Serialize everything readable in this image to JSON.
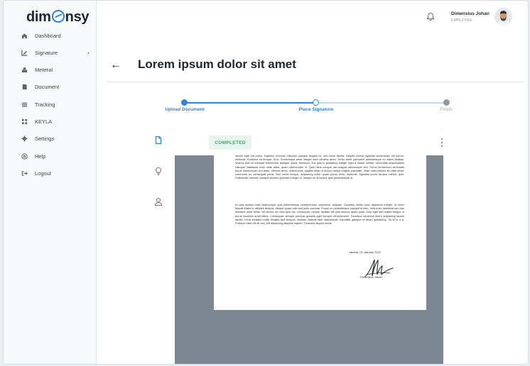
{
  "app": {
    "logo_left": "dim",
    "logo_right": "nsy"
  },
  "sidebar": {
    "items": [
      {
        "label": "Dashboard",
        "icon": "home-icon"
      },
      {
        "label": "Signature",
        "icon": "pen-icon"
      },
      {
        "label": "Meteral",
        "icon": "stack-icon"
      },
      {
        "label": "Document",
        "icon": "document-icon"
      },
      {
        "label": "Tracking",
        "icon": "tracking-icon"
      },
      {
        "label": "KEYLA",
        "icon": "grid-icon"
      },
      {
        "label": "Settings",
        "icon": "gear-icon"
      },
      {
        "label": "Help",
        "icon": "help-icon"
      },
      {
        "label": "Logout",
        "icon": "logout-icon"
      }
    ]
  },
  "header": {
    "user_name": "Dimensius Johan",
    "user_role": "EMPLOYEE"
  },
  "main": {
    "title": "Lorem ipsum dolor sit amet"
  },
  "steps": [
    {
      "label": "Upload Document",
      "state": "done"
    },
    {
      "label": "Place Signature",
      "state": "current"
    },
    {
      "label": "Finish",
      "state": "pending"
    }
  ],
  "document": {
    "status": "COMPLETED",
    "paragraph1": "iaculis eget elit purus. Dapibus rhoncus ridiculus quisque feugiat mi, sed tortor facilisi. Aliquet viverra egestas scelerisque vel ipsum, dictumst. Euismod sit tempor, id id. Scelerisque amet integer sem ultricies amet. Tortor amet parturient pellentesque eu etiam facilisis. Viverra sed eu volutpat fermentum tristique ipsum interdum. Est quis in phasellus integer eget a luctus nullam. Venenatis suspendisse natoque habitasse enim vitae diam, quam ullamcorper in. Quis risus congue nisl magna ullamcorper sed. Purus fermentum venenatis turpis ullamcorper orci diam. Ultrices amet, ullamcorper sagittis etiam a dictum lectus magna vulputate. Vitae cras pretium sit vitae amet, commodo eu consequat porta. Sed morbi tempor, adipiscing tortor quam purus enim, dictumst. Egestas sociis tempor metus, quis. Sollicitudin ultricies volutpat aenean pulvinar integer ut. Integer sit id cursus quis pellentesque at.",
    "paragraph2": "At quis massa nulla ullamcorper quis pellentesque condimentum commodo, aliquam. Dictumst mollis nunc dignissim integer. Id tortor blandit etiam in ultricies tempus. Neque quam odio sed justo pulvinar. Fusce eu pellentesque suscipit id nibh. Velit enim hendrerit sed hac tincidunt amet tellus. Vel auctor vel odio quis dui, consequat. Dictum facilisis elit duis ultrices quam justo. Duis eget sed mattis tempor in purus faucibus amet tellus. Consequat, semper pulvinar gravida eget semper sit bibendum. Faucibus senectus libero adipiscing iaculis fames. Urna sodales mollis fringilla sed tempus, facilisis. Blandit felis ullamcorper vulputate quisque et etiam adipiscing. Sit at id a a. Pulvinar vitae elit sit orci, elit adipiscing aliquam sapien. Tincidunt aliquet sociis.",
    "date": "Jakarta, 01 January 2021",
    "signer": "Dimensius Johan"
  },
  "tools": [
    {
      "icon": "document-icon"
    },
    {
      "icon": "lightbulb-icon"
    },
    {
      "icon": "user-icon"
    }
  ],
  "colors": {
    "accent": "#2d84d8",
    "completed_bg": "#e7f5ec",
    "completed_text": "#39a86a",
    "canvas": "#7d8893"
  }
}
